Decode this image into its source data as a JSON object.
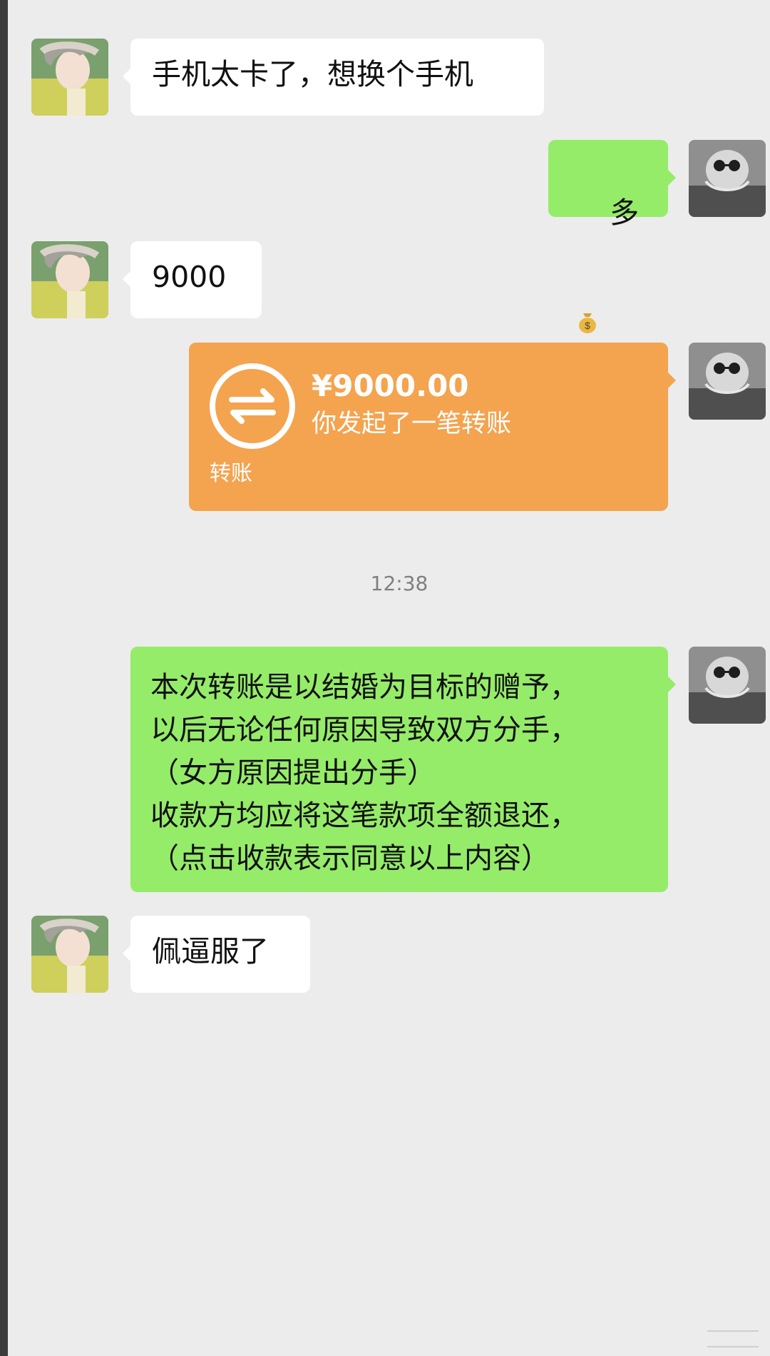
{
  "chat": {
    "messages": [
      {
        "side": "left",
        "type": "text",
        "text": "手机太卡了，想换个手机"
      },
      {
        "side": "right",
        "type": "text",
        "text": "多",
        "emoji": "money-bag-icon"
      },
      {
        "side": "left",
        "type": "text",
        "text": "9000"
      },
      {
        "side": "right",
        "type": "transfer",
        "amount": "¥9000.00",
        "note": "你发起了一笔转账",
        "label": "转账"
      },
      {
        "side": "center",
        "type": "timestamp",
        "text": "12:38"
      },
      {
        "side": "right",
        "type": "text",
        "text": "本次转账是以结婚为目标的赠予，\n以后无论任何原因导致双方分手，\n（女方原因提出分手）\n收款方均应将这笔款项全额退还，\n（点击收款表示同意以上内容）"
      },
      {
        "side": "left",
        "type": "text",
        "text": "佩逼服了"
      }
    ]
  },
  "colors": {
    "background": "#ececec",
    "incoming_bubble": "#ffffff",
    "outgoing_bubble": "#95ec69",
    "transfer_bubble": "#f4a34f",
    "timestamp_text": "#7f7f7f"
  }
}
